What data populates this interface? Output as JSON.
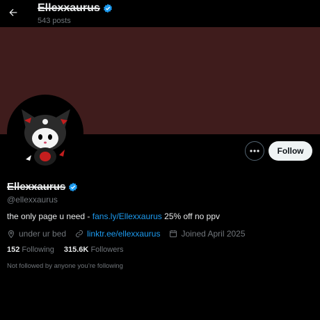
{
  "header": {
    "title": "Ellexxaurus",
    "posts_count": "543 posts"
  },
  "profile": {
    "display_name": "Ellexxaurus",
    "handle": "@ellexxaurus",
    "bio_prefix": "the only page u need - ",
    "bio_link": "fans.ly/Ellexxaurus",
    "bio_suffix": " 25% off no ppv",
    "location": "under ur bed",
    "website": "linktr.ee/ellexxaurus",
    "joined": "Joined April 2025",
    "following_count": "152",
    "following_label": "Following",
    "followers_count": "315.6K",
    "followers_label": "Followers",
    "not_followed_text": "Not followed by anyone you’re following"
  },
  "actions": {
    "follow_label": "Follow",
    "more_icon": "more-dots-icon"
  },
  "colors": {
    "banner": "#3f1c1c",
    "accent": "#1d9bf0",
    "verified": "#1d9bf0"
  }
}
